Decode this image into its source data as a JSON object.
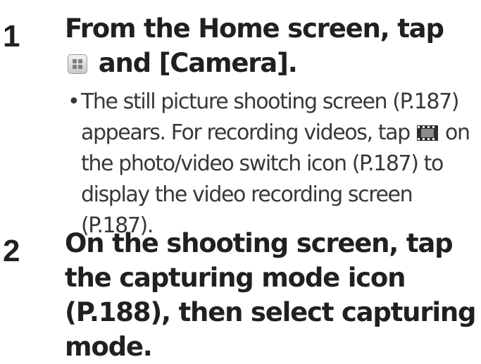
{
  "steps": [
    {
      "number": "1",
      "title_part1": "From the Home screen, tap",
      "icon": "apps-grid-icon",
      "title_part2": "and [Camera].",
      "note_bullet": "•",
      "note_part1": "The still picture shooting screen (P.187) appears. For recording videos, tap",
      "note_icon": "video-film-icon",
      "note_part2": "on the photo/video switch icon (P.187) to display the video recording screen (P.187)."
    },
    {
      "number": "2",
      "title": "On the shooting screen, tap the capturing mode icon (P.188), then select capturing mode."
    }
  ]
}
